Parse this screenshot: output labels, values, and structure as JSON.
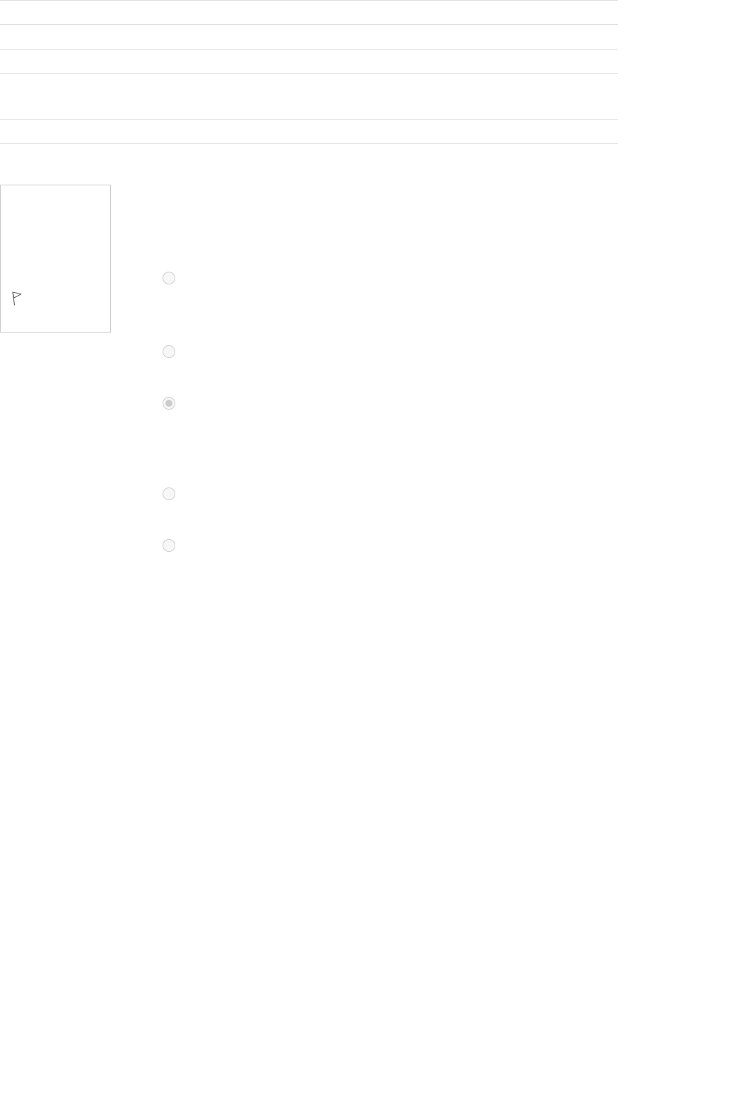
{
  "summary": {
    "rows": [
      {
        "label": "",
        "value": ""
      },
      {
        "label": "",
        "value": ""
      },
      {
        "label": "",
        "value": ""
      },
      {
        "label": "",
        "value": ""
      },
      {
        "label": "",
        "value": ""
      }
    ]
  },
  "question_info": {
    "flag_icon": "flag-icon"
  },
  "answers": {
    "options": [
      {
        "label": "",
        "checked": false
      },
      {
        "label": "",
        "checked": false
      },
      {
        "label": "",
        "checked": true
      },
      {
        "label": "",
        "checked": false
      },
      {
        "label": "",
        "checked": false
      }
    ]
  },
  "colors": {
    "border": "#dedede",
    "radio_border": "#cfcfcf",
    "radio_fill": "#f7f7f7",
    "radio_checked_dot": "#cccccc"
  }
}
